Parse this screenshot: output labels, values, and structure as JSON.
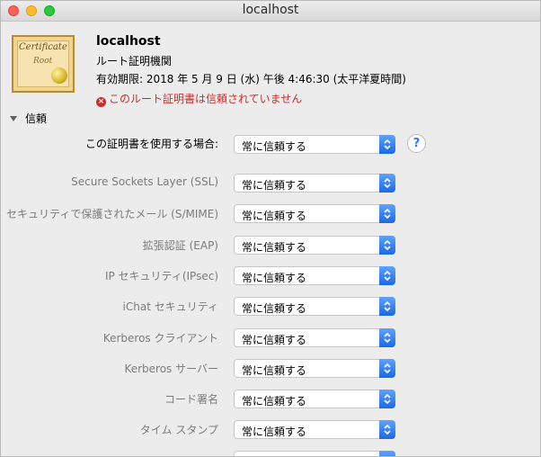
{
  "window": {
    "title": "localhost"
  },
  "certificate": {
    "icon_label": "certificate-icon",
    "icon_text_top": "Certificate",
    "icon_text_bottom": "Root",
    "name": "localhost",
    "type": "ルート証明機関",
    "expiry": "有効期限: 2018 年 5 月 9 日 (水) 午後 4:46:30 (太平洋夏時間)",
    "status": "このルート証明書は信頼されていません",
    "status_icon": "error-icon",
    "status_color": "#d22a28"
  },
  "trust": {
    "section_label": "信頼",
    "main_label": "この証明書を使用する場合:",
    "main_value": "常に信頼する",
    "help_label": "?",
    "rows": [
      {
        "label": "Secure Sockets Layer (SSL)",
        "value": "常に信頼する"
      },
      {
        "label": "セキュリティで保護されたメール (S/MIME)",
        "value": "常に信頼する"
      },
      {
        "label": "拡張認証 (EAP)",
        "value": "常に信頼する"
      },
      {
        "label": "IP セキュリティ(IPsec)",
        "value": "常に信頼する"
      },
      {
        "label": "iChat セキュリティ",
        "value": "常に信頼する"
      },
      {
        "label": "Kerberos クライアント",
        "value": "常に信頼する"
      },
      {
        "label": "Kerberos サーバー",
        "value": "常に信頼する"
      },
      {
        "label": "コード署名",
        "value": "常に信頼する"
      },
      {
        "label": "タイム スタンプ",
        "value": "常に信頼する"
      },
      {
        "label": "",
        "value": ""
      }
    ]
  },
  "colors": {
    "accent": "#1a69e6",
    "window_bg": "#ececec"
  }
}
